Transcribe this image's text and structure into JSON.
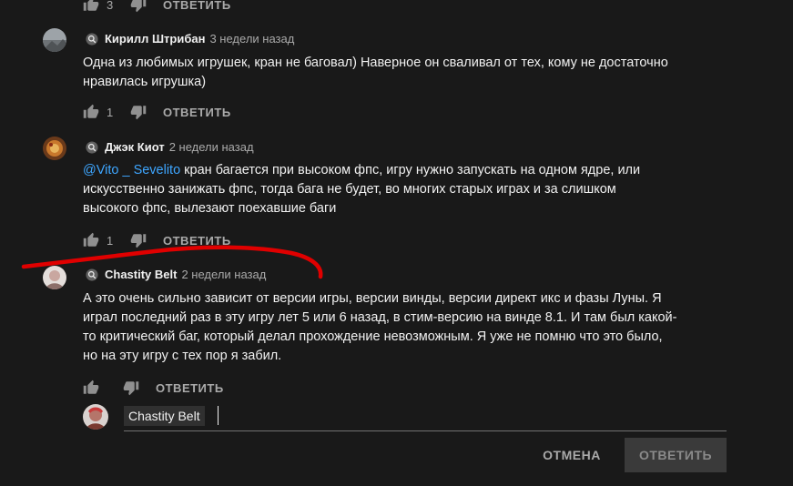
{
  "colors": {
    "background": "#191919",
    "mention": "#3ea6ff",
    "annotation": "#e00000",
    "muted": "#aaaaaa"
  },
  "top_actions": {
    "likes": "3",
    "reply_label": "ОТВЕТИТЬ"
  },
  "comments": [
    {
      "author": "Кирилл Штрибан",
      "time": "3 недели назад",
      "text_lines": [
        "Одна из любимых игрушек, кран не баговал) Наверное он сваливал от тех, кому не достаточно",
        "нравилась игрушка)"
      ],
      "likes": "1",
      "reply_label": "ОТВЕТИТЬ"
    },
    {
      "author": "Джэк Киот",
      "time": "2 недели назад",
      "mention": "@Vito _ Sevelito",
      "text_lines": [
        " кран багается при высоком фпс, игру нужно запускать на одном ядре, или",
        "искусственно занижать фпс, тогда бага не будет, во многих старых играх и за слишком",
        "высокого фпс, вылезают поехавшие баги"
      ],
      "likes": "1",
      "reply_label": "ОТВЕТИТЬ"
    },
    {
      "author": "Chastity Belt",
      "time": "2 недели назад",
      "text_lines": [
        "А это очень сильно зависит от версии игры, версии винды, версии директ икс и фазы Луны. Я",
        "играл последний раз в эту игру лет 5 или 6 назад, в стим-версию на винде 8.1. И там был какой-",
        "то критический баг, который делал прохождение невозможным. Я уже не помню что это было,",
        "но на эту игру с тех пор я забил."
      ],
      "likes": "",
      "reply_label": "ОТВЕТИТЬ"
    }
  ],
  "reply_box": {
    "mention_chip": "Chastity Belt"
  },
  "buttons": {
    "cancel": "ОТМЕНА",
    "submit": "ОТВЕТИТЬ"
  }
}
